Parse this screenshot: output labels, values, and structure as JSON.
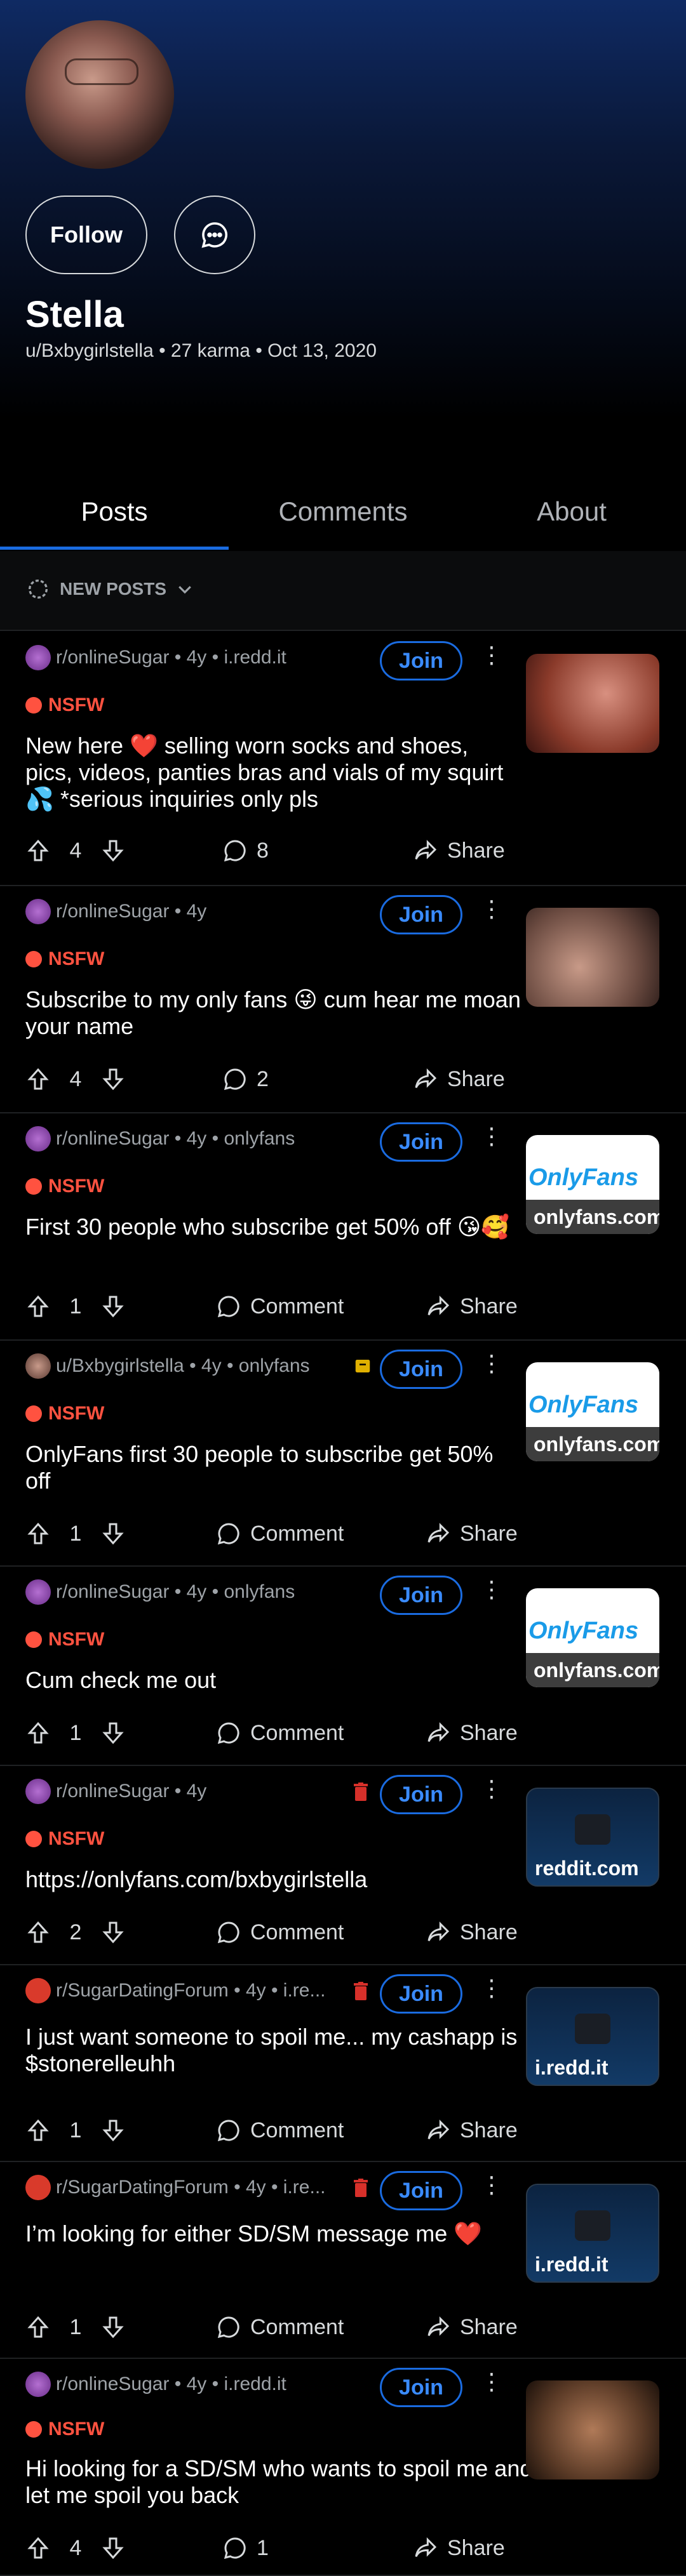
{
  "profile": {
    "display_name": "Stella",
    "meta": "u/Bxbygirlstella • 27 karma • Oct 13, 2020",
    "follow_label": "Follow"
  },
  "tabs": [
    "Posts",
    "Comments",
    "About"
  ],
  "sort_label": "NEW POSTS",
  "colors": {
    "accent": "#1a6be0",
    "nsfw": "#ff5240",
    "background": "#000000"
  },
  "posts": [
    {
      "header": "r/onlineSugar • 4y • i.redd.it",
      "join": "Join",
      "tag": "NSFW",
      "title": "New here ❤️ selling worn socks and shoes, pics, videos, panties bras and vials of my squirt 💦 *serious inquiries only pls",
      "votes": "4",
      "comments": "8",
      "share": "Share",
      "thumb_caption": ""
    },
    {
      "header": "r/onlineSugar • 4y",
      "join": "Join",
      "tag": "NSFW",
      "title": "Subscribe to my only fans 😜 cum hear me moan your name",
      "votes": "4",
      "comments": "2",
      "share": "Share",
      "thumb_caption": ""
    },
    {
      "header": "r/onlineSugar • 4y • onlyfans",
      "join": "Join",
      "tag": "NSFW",
      "title": "First 30 people who subscribe get 50% off 😘🥰",
      "votes": "1",
      "comments": "Comment",
      "share": "Share",
      "thumb_logo": "OnlyFans",
      "thumb_caption": "onlyfans.com"
    },
    {
      "header": "u/Bxbygirlstella • 4y • onlyfans",
      "join": "Join",
      "tag": "NSFW",
      "title": "OnlyFans first 30 people to subscribe get 50% off",
      "votes": "1",
      "comments": "Comment",
      "share": "Share",
      "thumb_logo": "OnlyFans",
      "thumb_caption": "onlyfans.com"
    },
    {
      "header": "r/onlineSugar • 4y • onlyfans",
      "join": "Join",
      "tag": "NSFW",
      "title": "Cum check me out",
      "votes": "1",
      "comments": "Comment",
      "share": "Share",
      "thumb_logo": "OnlyFans",
      "thumb_caption": "onlyfans.com"
    },
    {
      "header": "r/onlineSugar • 4y",
      "join": "Join",
      "tag": "NSFW",
      "title": "https://onlyfans.com/bxbygirlstella",
      "votes": "2",
      "comments": "Comment",
      "share": "Share",
      "thumb_caption": "reddit.com"
    },
    {
      "header": "r/SugarDatingForum • 4y • i.re...",
      "join": "Join",
      "tag": "",
      "title": "I just want someone to spoil me... my cashapp is $stonerelleuhh",
      "votes": "1",
      "comments": "Comment",
      "share": "Share",
      "thumb_caption": "i.redd.it"
    },
    {
      "header": "r/SugarDatingForum • 4y • i.re...",
      "join": "Join",
      "tag": "",
      "title": "I’m looking for either SD/SM message me ❤️",
      "votes": "1",
      "comments": "Comment",
      "share": "Share",
      "thumb_caption": "i.redd.it"
    },
    {
      "header": "r/onlineSugar • 4y • i.redd.it",
      "join": "Join",
      "tag": "NSFW",
      "title": "Hi looking for a SD/SM who wants to spoil me and let me spoil you back",
      "votes": "4",
      "comments": "1",
      "share": "Share",
      "thumb_caption": ""
    }
  ]
}
